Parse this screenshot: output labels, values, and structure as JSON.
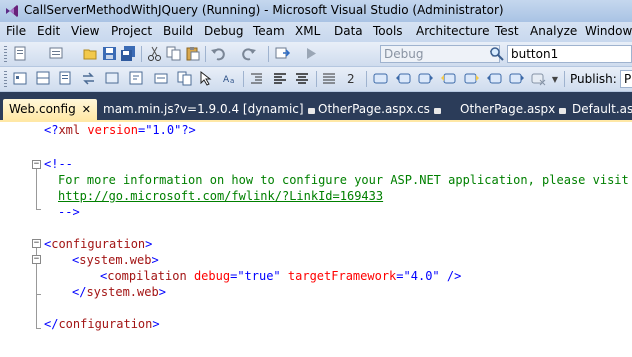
{
  "window": {
    "title": "CallServerMethodWithJQuery (Running) - Microsoft Visual Studio (Administrator)"
  },
  "menu": {
    "items": [
      "File",
      "Edit",
      "View",
      "Project",
      "Build",
      "Debug",
      "Team",
      "XML",
      "Data",
      "Tools",
      "Architecture",
      "Test",
      "Analyze",
      "Window"
    ]
  },
  "toolbar": {
    "config_combo": "Debug",
    "find_combo": "button1",
    "publish_label": "Publish:",
    "publish_combo": "P"
  },
  "tabs": [
    {
      "label": "Web.config",
      "active": true,
      "close": "✕"
    },
    {
      "label": "mam.min.js?v=1.9.0.4 [dynamic]",
      "active": false
    },
    {
      "label": "OtherPage.aspx.cs",
      "active": false
    },
    {
      "label": "OtherPage.aspx",
      "active": false
    },
    {
      "label": "Default.aspx",
      "active": false
    }
  ],
  "editor": {
    "l1_open": "<?",
    "l1_name": "xml",
    "l1_attr": "version",
    "l1_eq": "=",
    "l1_val": "\"1.0\"",
    "l1_close": "?>",
    "l2_comment_start": "<!--",
    "l3_comment_text": "For more information on how to configure your ASP.NET application, please visit",
    "l4_comment_link": "http://go.microsoft.com/fwlink/?LinkId=169433",
    "l5_comment_end": "-->",
    "l6_lt": "<",
    "l6_tag": "configuration",
    "l6_gt": ">",
    "l7_lt": "<",
    "l7_tag": "system.web",
    "l7_gt": ">",
    "l8_lt": "<",
    "l8_tag": "compilation",
    "l8_attr1": "debug",
    "l8_eq1": "=",
    "l8_val1": "\"true\"",
    "l8_attr2": "targetFramework",
    "l8_eq2": "=",
    "l8_val2": "\"4.0\"",
    "l8_end": "/>",
    "l9_lt": "</",
    "l9_tag": "system.web",
    "l9_gt": ">",
    "l10_lt": "</",
    "l10_tag": "configuration",
    "l10_gt": ">",
    "fold_minus": "−"
  },
  "icons": [
    "visual-studio-icon",
    "new-project-icon",
    "add-item-icon",
    "open-file-icon",
    "save-icon",
    "save-all-icon",
    "cut-icon",
    "copy-icon",
    "paste-icon",
    "undo-icon",
    "redo-icon",
    "navigate-icon",
    "start-debug-icon",
    "find-icon"
  ],
  "colors": {
    "titlebar": "#b8cde9",
    "tabstrip": "#2b3c59",
    "active_tab": "#ffedb5",
    "xml_tag": "#a31515",
    "xml_delim": "#0000ff",
    "xml_attr": "#ff0000",
    "comment": "#008000"
  }
}
